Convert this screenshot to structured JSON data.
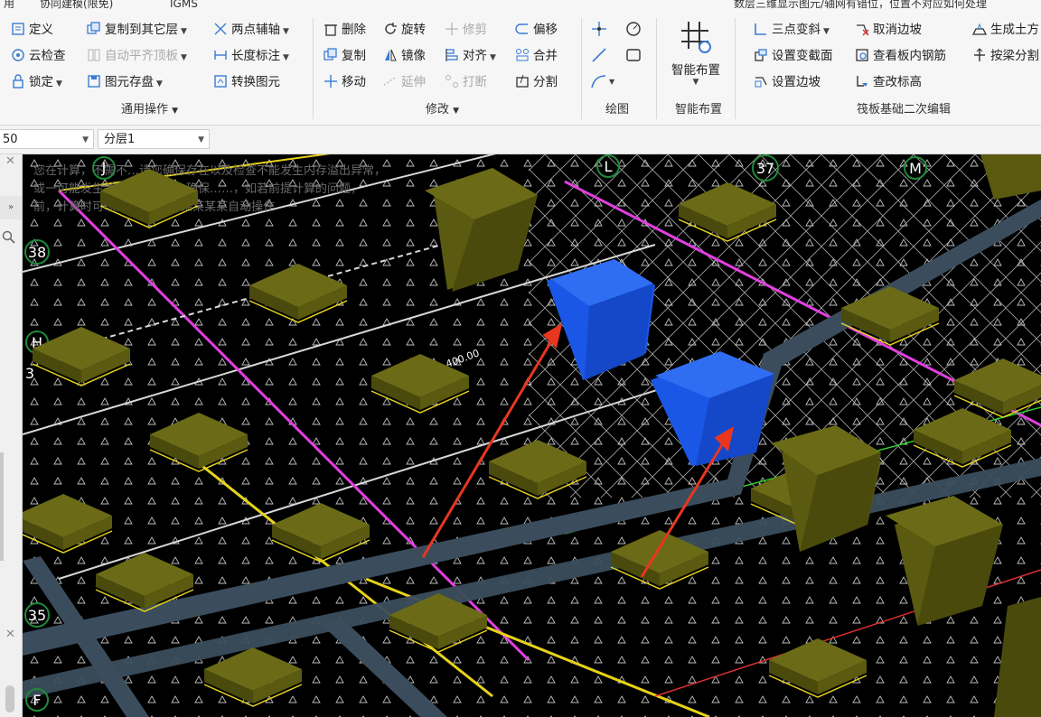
{
  "menubar": {
    "items": [
      "用",
      "协同建模(限免)",
      "IGMS"
    ],
    "right_text": "数层三维显示图元/轴网有错位，位置不对应如何处理"
  },
  "ribbon": {
    "general": {
      "label": "通用操作",
      "define": "定义",
      "copy_to_layer": "复制到其它层",
      "two_point_axis": "两点辅轴",
      "cloud_check": "云检查",
      "auto_flush_top": "自动平齐顶板",
      "length_dim": "长度标注",
      "lock": "锁定",
      "element_save": "图元存盘",
      "convert_element": "转换图元"
    },
    "modify": {
      "label": "修改",
      "delete": "删除",
      "rotate": "旋转",
      "trim": "修剪",
      "offset": "偏移",
      "copy": "复制",
      "mirror": "镜像",
      "align": "对齐",
      "merge": "合并",
      "move": "移动",
      "extend": "延伸",
      "break": "打断",
      "split": "分割"
    },
    "draw": {
      "label": "绘图"
    },
    "smart": {
      "label": "智能布置",
      "button": "智能布置"
    },
    "raft": {
      "label": "筏板基础二次编辑",
      "three_point_slope": "三点变斜",
      "cancel_edge_slope": "取消边坡",
      "generate_earthwork": "生成土方",
      "set_variable_section": "设置变截面",
      "view_rebar": "查看板内钢筋",
      "split_by_beam": "按梁分割",
      "set_edge_slope": "设置边坡",
      "check_elevation": "查改标高"
    }
  },
  "toolbar": {
    "floor_value": "50",
    "layer_value": "分层1"
  },
  "viewport": {
    "warning_lines": [
      "您在计算，不需不…请您确保存在以及检查不能发生内存溢出异常，",
      "或一可能发生关系计算异常，确保……，如若前提计算的问题，",
      "前，计算时可以用…2026年某某某某自动操作"
    ],
    "axis_labels": [
      "J",
      "L",
      "37",
      "M",
      "38",
      "H",
      "3",
      "35",
      "F"
    ],
    "dim_labels": [
      "400.00"
    ],
    "colors": {
      "pile_top": "#6b6b17",
      "pile_side": "#4a4a0c",
      "pile_selected": "#1a57e6",
      "beam": "#3b4d5c",
      "arrow": "#e8361f",
      "axis_circle": "#1f8a3a",
      "grid_line_white": "#d8d8d8",
      "magenta_line": "#e040e0"
    }
  }
}
